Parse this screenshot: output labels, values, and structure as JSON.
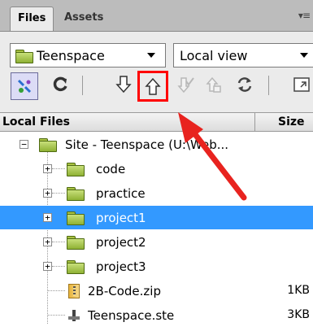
{
  "tabs": [
    {
      "label": "Files",
      "active": true
    },
    {
      "label": "Assets",
      "active": false
    }
  ],
  "tab_menu_glyph": "▾≡",
  "site_dropdown": {
    "value": "Teenspace"
  },
  "view_dropdown": {
    "value": "Local view"
  },
  "toolbar": {
    "connect": "connect-icon",
    "refresh": "refresh-icon",
    "get": "get-files-icon",
    "put": "put-files-icon",
    "check_out": "check-out-icon",
    "check_in": "check-in-icon",
    "synchronize": "synchronize-icon",
    "expand": "expand-icon"
  },
  "columns": {
    "name": "Local Files",
    "size": "Size"
  },
  "tree": {
    "root": {
      "label": "Site - Teenspace (U:\\Web...",
      "expanded": true
    },
    "items": [
      {
        "label": "code",
        "type": "folder",
        "expander": "+",
        "selected": false
      },
      {
        "label": "practice",
        "type": "folder",
        "expander": "+",
        "selected": false
      },
      {
        "label": "project1",
        "type": "folder",
        "expander": "+",
        "selected": true
      },
      {
        "label": "project2",
        "type": "folder",
        "expander": "+",
        "selected": false
      },
      {
        "label": "project3",
        "type": "folder",
        "expander": "+",
        "selected": false
      },
      {
        "label": "2B-Code.zip",
        "type": "zip",
        "size": "1KB",
        "selected": false
      },
      {
        "label": "Teenspace.ste",
        "type": "ste",
        "size": "3KB",
        "selected": false
      }
    ]
  },
  "colors": {
    "highlight_box": "#ff0000",
    "annotation_arrow": "#e8231f",
    "selection": "#3399ff"
  }
}
